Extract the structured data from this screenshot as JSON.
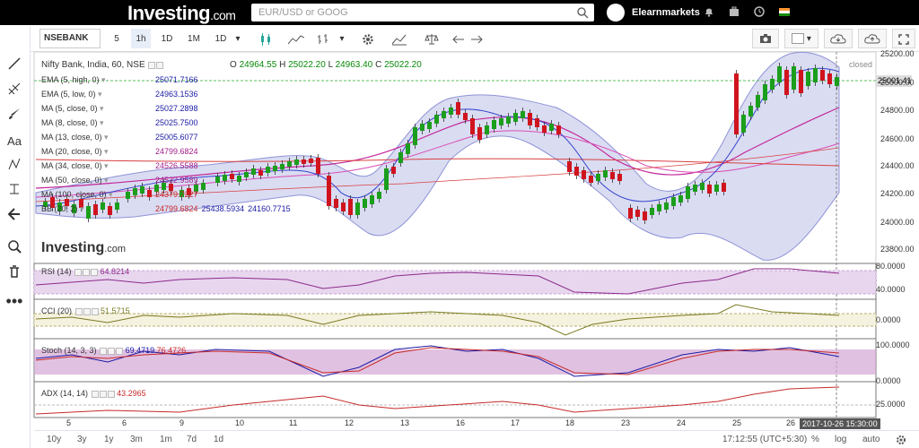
{
  "header": {
    "logo": "Investing",
    "logo_suffix": ".com",
    "search_placeholder": "EUR/USD or GOOG",
    "user_name": "Elearnmarkets"
  },
  "toolbar": {
    "symbol": "NSEBANK",
    "intervals": [
      "5",
      "1h",
      "1D",
      "1M",
      "1D"
    ],
    "selected_interval": "1h"
  },
  "chart": {
    "title": "Nifty Bank, India, 60, NSE",
    "ohlc": {
      "o_label": "O",
      "o": "24964.55",
      "h_label": "H",
      "h": "25022.20",
      "l_label": "L",
      "l": "24963.40",
      "c_label": "C",
      "c": "25022.20"
    },
    "indicators": [
      {
        "label": "EMA (5, high, 0)",
        "value": "25071.7166",
        "color": "#1a1aa6"
      },
      {
        "label": "EMA (5, low, 0)",
        "value": "24963.1536",
        "color": "#1a1aa6"
      },
      {
        "label": "MA (5, close, 0)",
        "value": "25027.2898",
        "color": "#1a1aa6"
      },
      {
        "label": "MA (8, close, 0)",
        "value": "25025.7500",
        "color": "#1a1aa6"
      },
      {
        "label": "MA (13, close, 0)",
        "value": "25005.6077",
        "color": "#1a1aa6"
      },
      {
        "label": "MA (20, close, 0)",
        "value": "24799.6824",
        "color": "#a01e8a"
      },
      {
        "label": "MA (34, close, 0)",
        "value": "24526.5588",
        "color": "#a01e8a"
      },
      {
        "label": "MA (50, close, 0)",
        "value": "24532.9589",
        "color": "#a01e8a"
      },
      {
        "label": "MA (100, close, 0)",
        "value": "24379.7227",
        "color": "#c72a2a"
      },
      {
        "label": "BB (20, 2)",
        "values": [
          "24799.6824",
          "25438.5934",
          "24160.7715"
        ],
        "colors": [
          "#c72a2a",
          "#1a1aa6",
          "#1a1aa6"
        ]
      }
    ],
    "closed_label": "closed",
    "last_price": "25001.41",
    "watermark": "Investing",
    "watermark_suffix": ".com",
    "price_axis": [
      "25200.00",
      "25000.00",
      "24800.00",
      "24600.00",
      "24400.00",
      "24200.00",
      "24000.00",
      "23800.00"
    ]
  },
  "rsi": {
    "label": "RSI (14)",
    "value": "64.8214",
    "axis": [
      "80.0000",
      "40.0000"
    ]
  },
  "cci": {
    "label": "CCI (20)",
    "value": "51.5715",
    "axis": [
      "0.0000"
    ]
  },
  "stoch": {
    "label": "Stoch (14, 3, 3)",
    "value1": "69.4719",
    "value2": "76.4726",
    "axis": [
      "100.0000",
      "0.0000"
    ]
  },
  "adx": {
    "label": "ADX (14, 14)",
    "value": "43.2965",
    "axis": [
      "25.0000"
    ]
  },
  "x_axis": [
    "5",
    "6",
    "9",
    "10",
    "11",
    "12",
    "13",
    "16",
    "17",
    "18",
    "23",
    "24",
    "25",
    "26"
  ],
  "cursor_date": "2017-10-26 15:30:00",
  "bottom": {
    "ranges": [
      "10y",
      "3y",
      "1y",
      "3m",
      "1m",
      "7d",
      "1d"
    ],
    "time": "17:12:55 (UTC+5:30)",
    "pct": "%",
    "log": "log",
    "auto": "auto"
  },
  "colors": {
    "up": "#1b9e1b",
    "down": "#d0141e",
    "bb_fill": "#dadcf2",
    "osc_fill": "#e8d6ee",
    "stoch_fill": "#d4a6d4"
  }
}
